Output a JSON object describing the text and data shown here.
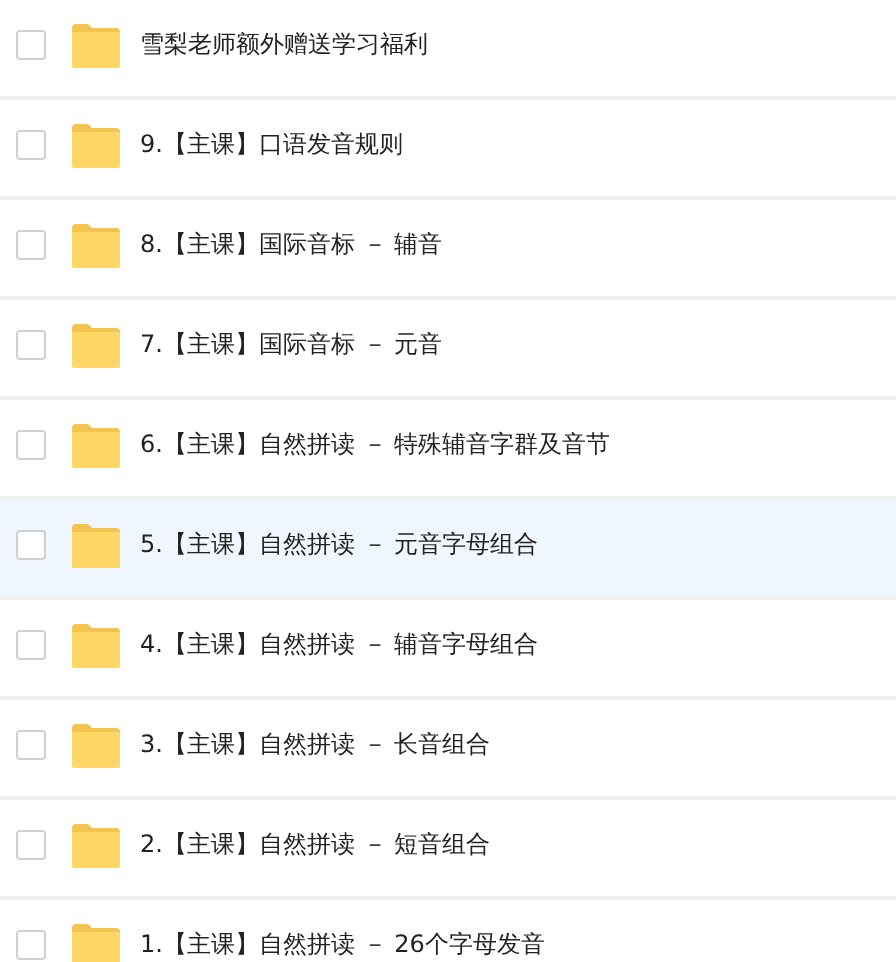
{
  "files": [
    {
      "name": "雪梨老师额外赠送学习福利",
      "checked": false,
      "hovered": false
    },
    {
      "name": "9.【主课】口语发音规则",
      "checked": false,
      "hovered": false
    },
    {
      "name": "8.【主课】国际音标 － 辅音",
      "checked": false,
      "hovered": false
    },
    {
      "name": "7.【主课】国际音标 － 元音",
      "checked": false,
      "hovered": false
    },
    {
      "name": "6.【主课】自然拼读 － 特殊辅音字群及音节",
      "checked": false,
      "hovered": false
    },
    {
      "name": "5.【主课】自然拼读 － 元音字母组合",
      "checked": false,
      "hovered": true
    },
    {
      "name": "4.【主课】自然拼读 － 辅音字母组合",
      "checked": false,
      "hovered": false
    },
    {
      "name": "3.【主课】自然拼读 － 长音组合",
      "checked": false,
      "hovered": false
    },
    {
      "name": "2.【主课】自然拼读 － 短音组合",
      "checked": false,
      "hovered": false
    },
    {
      "name": "1.【主课】自然拼读 － 26个字母发音",
      "checked": false,
      "hovered": false
    }
  ]
}
